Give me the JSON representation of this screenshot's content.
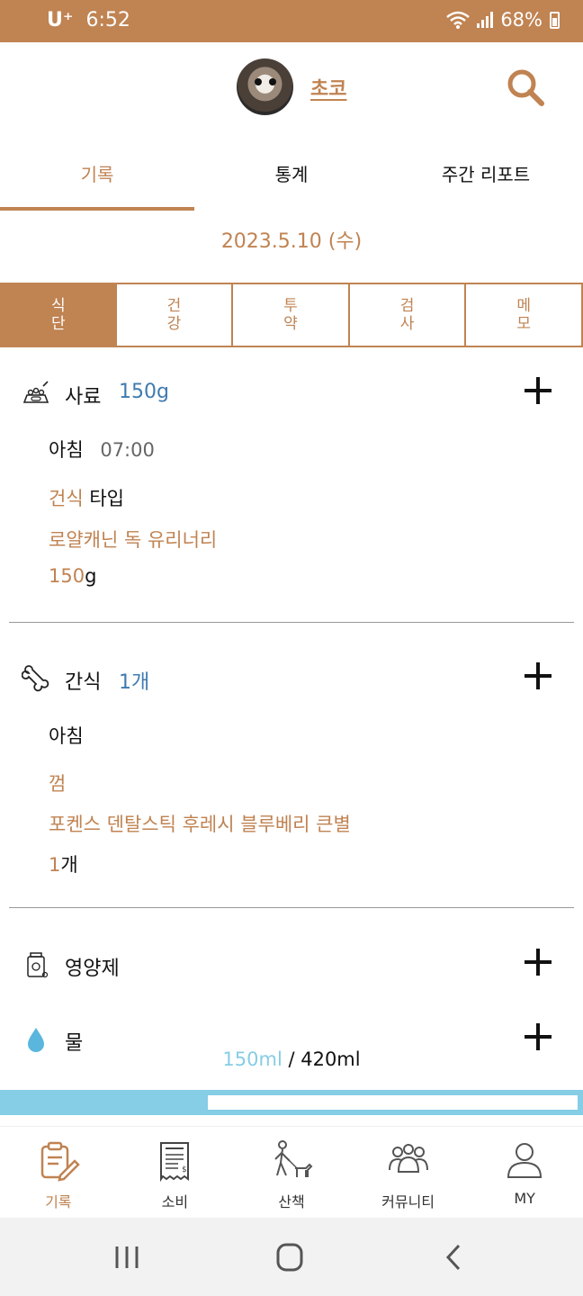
{
  "status_bar": {
    "carrier": "U⁺",
    "time": "6:52",
    "battery": "68%"
  },
  "profile": {
    "pet_name": "초코"
  },
  "tabs": [
    {
      "label": "기록",
      "active": true
    },
    {
      "label": "통계",
      "active": false
    },
    {
      "label": "주간 리포트",
      "active": false
    }
  ],
  "date": "2023.5.10 (수)",
  "categories": [
    {
      "label": "식단",
      "active": true
    },
    {
      "label": "건강",
      "active": false
    },
    {
      "label": "투약",
      "active": false
    },
    {
      "label": "검사",
      "active": false
    },
    {
      "label": "메모",
      "active": false
    }
  ],
  "food": {
    "title": "사료",
    "total": "150g",
    "time_label": "아침",
    "time": "07:00",
    "type": "건식",
    "type_suffix": "타입",
    "product": "로얄캐닌 독 유리너리",
    "amount": "150",
    "unit": "g"
  },
  "snack": {
    "title": "간식",
    "total": "1개",
    "time_label": "아침",
    "type": "껌",
    "product": "포켄스 덴탈스틱 후레시 블루베리 큰별",
    "amount": "1",
    "unit": "개"
  },
  "supplement": {
    "title": "영양제"
  },
  "water": {
    "title": "물",
    "current": "150ml",
    "separator": " / ",
    "goal": "420ml",
    "progress": 0.357
  },
  "bottom_nav": [
    {
      "label": "기록",
      "icon": "clipboard-icon",
      "active": true
    },
    {
      "label": "소비",
      "icon": "receipt-icon",
      "active": false
    },
    {
      "label": "산책",
      "icon": "dog-walk-icon",
      "active": false
    },
    {
      "label": "커뮤니티",
      "icon": "people-icon",
      "active": false
    },
    {
      "label": "MY",
      "icon": "user-icon",
      "active": false
    }
  ],
  "colors": {
    "accent": "#c08352",
    "count_blue": "#3f7bb0",
    "water_blue": "#86cde6"
  }
}
